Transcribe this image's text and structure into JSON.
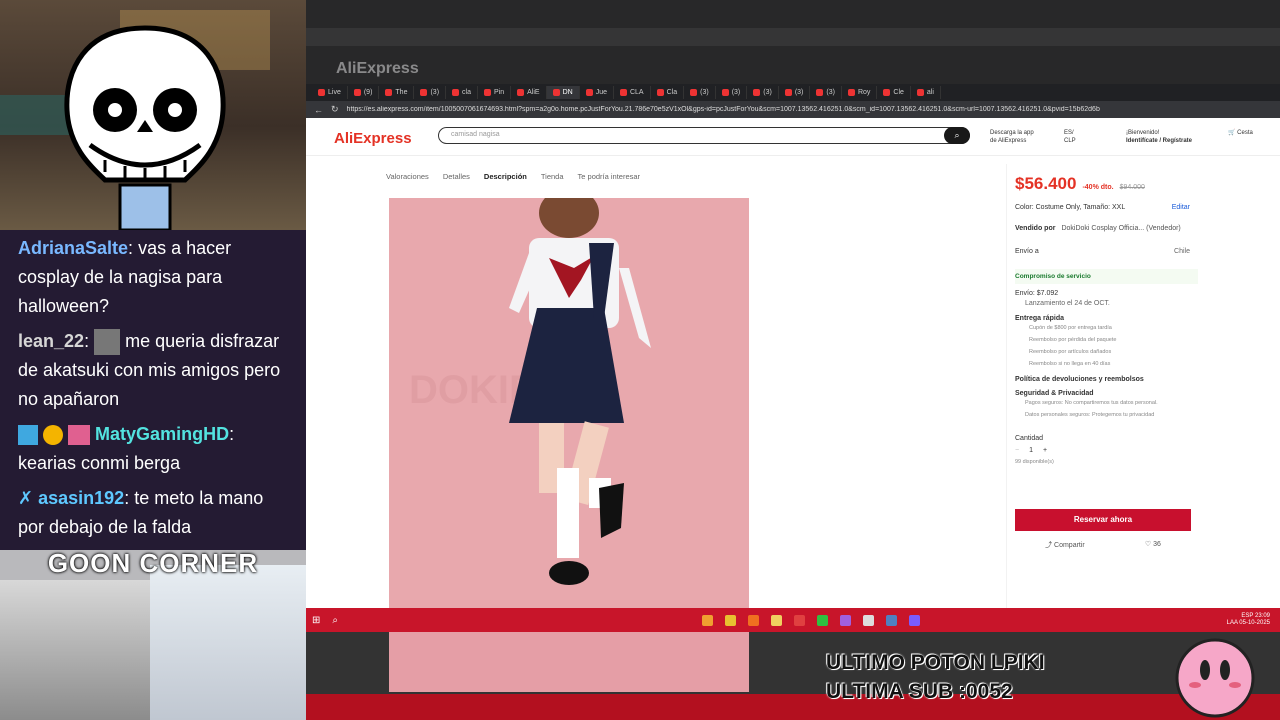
{
  "chat": [
    {
      "user": "AdrianaSalte",
      "color": "#79b8ff",
      "text": "vas a hacer cosplay de la nagisa para halloween?"
    },
    {
      "user": "lean_22",
      "color": "#d6d6d6",
      "text": "me queria disfrazar de akatsuki con mis amigos pero no apañaron"
    },
    {
      "user": "MatyGamingHD",
      "color": "#53e3e0",
      "text": "kearias conmi berga"
    },
    {
      "user": "asasin192",
      "color": "#5ec8ff",
      "text": "te meto la mano por debajo de la falda"
    }
  ],
  "overlay": {
    "goon_title": "GOON CORNER",
    "sub_line1": "ULTIMO POTON LPIKI",
    "sub_line2": "ULTIMA SUB :0052"
  },
  "browser": {
    "tabs": [
      "Live",
      "(9)",
      "The",
      "(3)",
      "cla",
      "Pin",
      "AliE",
      "DN",
      "Jue",
      "CLA",
      "Cla",
      "(3)",
      "(3)",
      "(3)",
      "(3)",
      "(3)",
      "Roy",
      "Cle",
      "ali"
    ],
    "url": "https://es.aliexpress.com/item/1005007061674693.html?spm=a2g0o.home.pcJustForYou.21.786e70e5zV1xOl&gps-id=pcJustForYou&scm=1007.13562.416251.0&scm_id=1007.13562.416251.0&scm-url=1007.13562.416251.0&pvid=15b62d6b"
  },
  "ali": {
    "logo": "AliExpress",
    "search_placeholder": "camisad nagisa",
    "header_login_1": "Descarga la app",
    "header_login_2": "de AliExpress",
    "header_country": "ES/",
    "header_currency": "CLP",
    "header_greeting": "¡Bienvenido!",
    "header_signin": "Identifícate / Regístrate",
    "cart_label": "Cesta",
    "cart_count": "0",
    "product_tabs": [
      "Valoraciones",
      "Detalles",
      "Descripción",
      "Tienda",
      "Te podría interesar"
    ],
    "active_tab": "Descripción",
    "price": "$56.400",
    "discount": "-40% dto.",
    "old_price": "$94.000",
    "variant": "Color: Costume Only, Tamaño: XXL",
    "edit": "Editar",
    "sold_by_label": "Vendido por",
    "seller": "DokiDoki Cosplay Officia... (Vendedor)",
    "ship_to": "Envío a",
    "ship_country": "Chile",
    "service_title": "Compromiso de servicio",
    "shipping": "Envío: $7.092",
    "launch": "Lanzamiento el 24 de OCT.",
    "fast_title": "Entrega rápida",
    "fast_items": [
      "Cupón de $800 por entrega tardía",
      "Reembolso por pérdida del paquete",
      "Reembolso por artículos dañados",
      "Reembolso si no llega en 40 días"
    ],
    "returns": "Política de devoluciones y reembolsos",
    "security": "Seguridad & Privacidad",
    "security_items": [
      "Pagos seguros: No compartiremos tus datos personal.",
      "Datos personales seguros: Protegemos tu privacidad"
    ],
    "qty_label": "Cantidad",
    "qty": "1",
    "available": "99 disponible(s)",
    "reserve": "Reservar ahora",
    "share": "Compartir",
    "likes": "36",
    "watermark": "DOKIDOKI"
  },
  "taskbar": {
    "lang1": "ESP",
    "lang2": "LAA",
    "time": "23:09",
    "date": "05-10-2025"
  }
}
